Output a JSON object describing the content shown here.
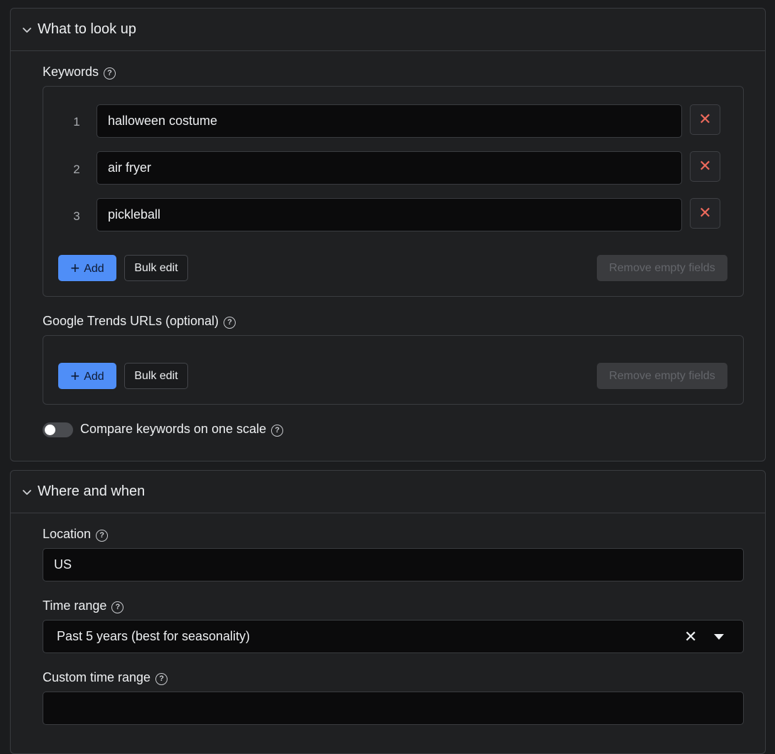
{
  "section_lookup": {
    "title": "What to look up",
    "keywords": {
      "label": "Keywords",
      "items": [
        {
          "index": "1",
          "value": "halloween costume"
        },
        {
          "index": "2",
          "value": "air fryer"
        },
        {
          "index": "3",
          "value": "pickleball"
        }
      ],
      "add_label": "Add",
      "bulk_edit_label": "Bulk edit",
      "remove_empty_label": "Remove empty fields"
    },
    "trends_urls": {
      "label": "Google Trends URLs (optional)",
      "add_label": "Add",
      "bulk_edit_label": "Bulk edit",
      "remove_empty_label": "Remove empty fields"
    },
    "compare_toggle": {
      "label": "Compare keywords on one scale",
      "enabled": false
    }
  },
  "section_where": {
    "title": "Where and when",
    "location": {
      "label": "Location",
      "value": "US"
    },
    "time_range": {
      "label": "Time range",
      "value": "Past 5 years (best for seasonality)"
    },
    "custom_time_range": {
      "label": "Custom time range",
      "value": ""
    }
  },
  "colors": {
    "accent": "#4f8ef7",
    "delete": "#ee6a5c",
    "background": "#1b1c1e"
  },
  "icons": {
    "section_toggle": "chevron-down-icon",
    "help": "help-circle-icon",
    "delete": "close-icon",
    "add": "plus-icon",
    "select_clear": "close-icon",
    "select_open": "caret-down-icon"
  }
}
